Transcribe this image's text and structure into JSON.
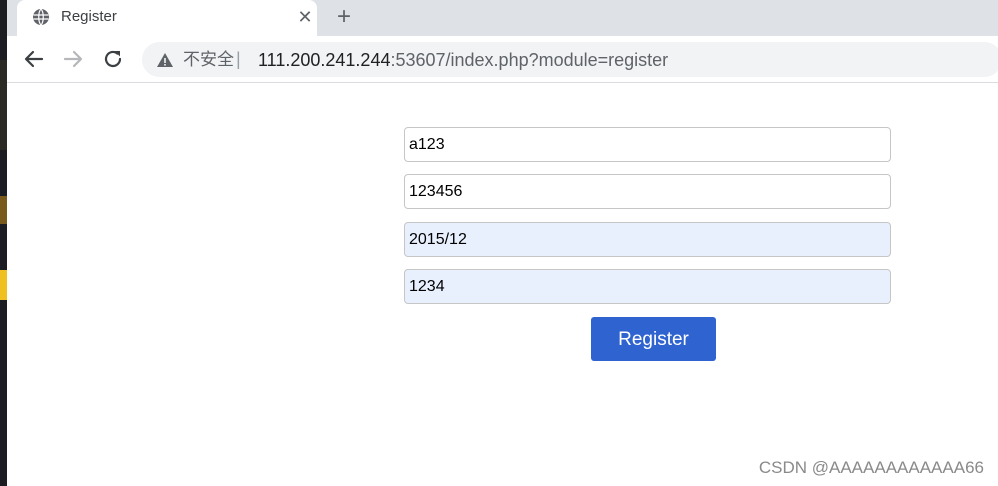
{
  "tab": {
    "title": "Register",
    "close_glyph": "✕",
    "new_tab_glyph": "+"
  },
  "omnibox": {
    "security_label": "不安全",
    "separator": "|",
    "url_host": "111.200.241.244",
    "url_rest": ":53607/index.php?module=register"
  },
  "form": {
    "fields": [
      {
        "value": "a123"
      },
      {
        "value": "123456"
      },
      {
        "value": "2015/12"
      },
      {
        "value": "1234"
      }
    ],
    "submit_label": "Register"
  },
  "watermark": "CSDN @AAAAAAAAAAAA66",
  "colors": {
    "button": "#2f63d0",
    "autofill_bg": "#e8f0fe",
    "tabstrip": "#dee1e6"
  },
  "icons": [
    "globe-icon",
    "close-icon",
    "plus-icon",
    "back-arrow-icon",
    "forward-arrow-icon",
    "reload-icon",
    "warning-icon"
  ]
}
